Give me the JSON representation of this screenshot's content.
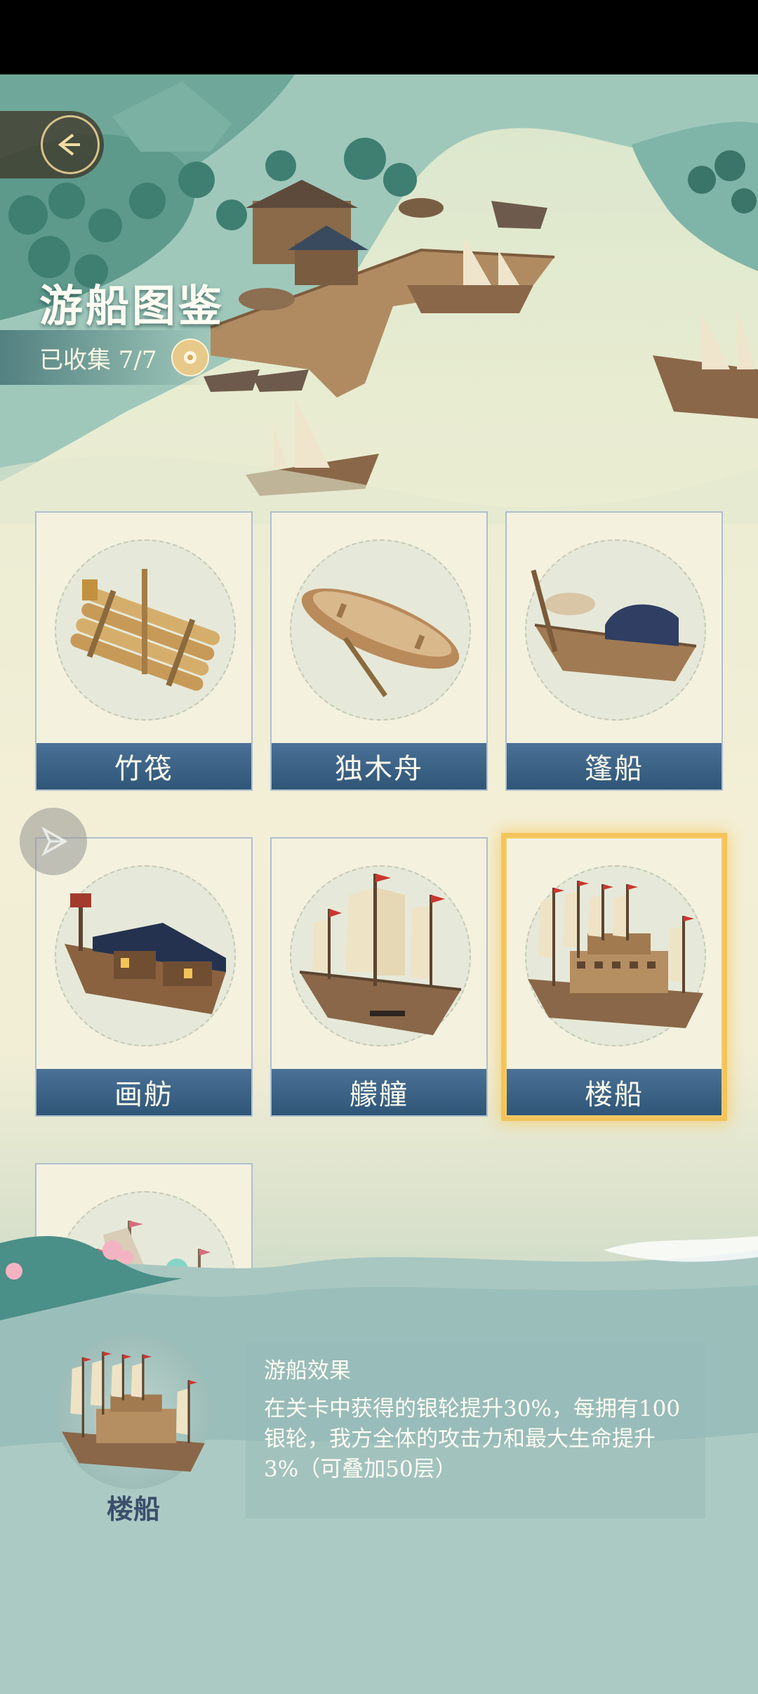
{
  "header": {
    "title": "游船图鉴",
    "collected_label": "已收集 7/7"
  },
  "ships": [
    {
      "name": "竹筏",
      "icon": "bamboo-raft-icon",
      "selected": false
    },
    {
      "name": "独木舟",
      "icon": "dugout-canoe-icon",
      "selected": false
    },
    {
      "name": "篷船",
      "icon": "canopy-boat-icon",
      "selected": false
    },
    {
      "name": "画舫",
      "icon": "painted-pleasure-boat-icon",
      "selected": false
    },
    {
      "name": "艨艟",
      "icon": "war-junk-icon",
      "selected": false
    },
    {
      "name": "楼船",
      "icon": "tower-ship-icon",
      "selected": true
    },
    {
      "name": "",
      "icon": "flagship-partial-icon",
      "selected": false
    }
  ],
  "info": {
    "ship_name": "楼船",
    "effect_title": "游船效果",
    "effect_text": "在关卡中获得的银轮提升30%，每拥有100银轮，我方全体的攻击力和最大生命提升3%（可叠加50层）"
  },
  "colors": {
    "label_bg": "#3c6688",
    "selected_glow": "#f3c45a",
    "title_text": "#fffdf3"
  }
}
